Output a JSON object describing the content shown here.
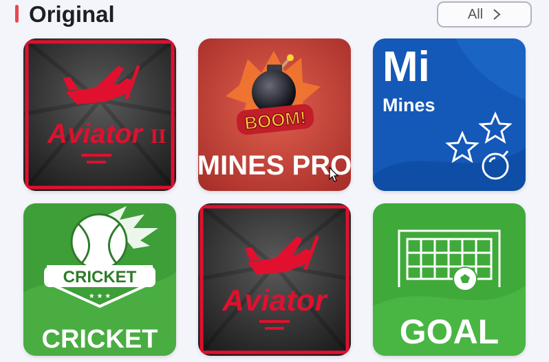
{
  "section": {
    "title": "Original",
    "all_label": "All"
  },
  "games": [
    {
      "title": "Aviator II",
      "logo_main": "Aviator",
      "logo_suffix": "II"
    },
    {
      "title": "MINES PRO",
      "badge": "BOOM!"
    },
    {
      "title": "Mi Mines",
      "logo_main": "Mi",
      "logo_sub": "Mines"
    },
    {
      "title": "CRICKET",
      "badge": "CRICKET"
    },
    {
      "title": "Aviator",
      "logo_main": "Aviator"
    },
    {
      "title": "GOAL"
    }
  ],
  "colors": {
    "accent": "#e8474f",
    "aviator_red": "#e0102e",
    "mines_red": "#c8433a",
    "mi_blue": "#1458b8",
    "green": "#3faa3a"
  },
  "icons": [
    "chevron-right-icon",
    "plane-icon",
    "bomb-icon",
    "star-icon",
    "ball-icon",
    "cricket-ball-icon",
    "goal-net-icon",
    "cursor-icon"
  ]
}
